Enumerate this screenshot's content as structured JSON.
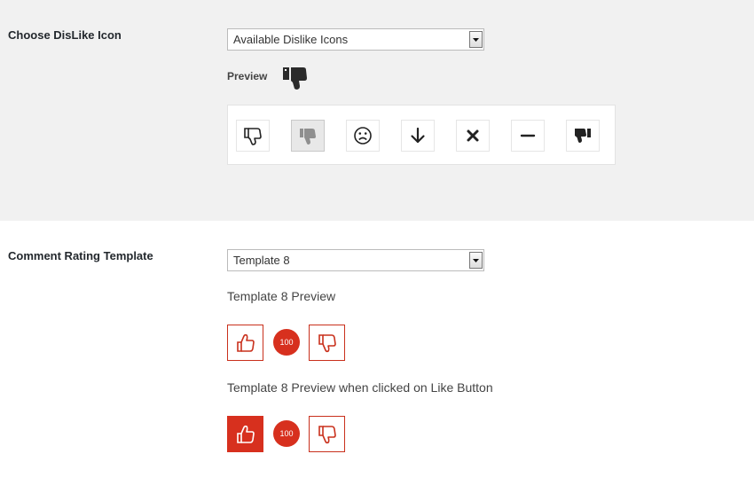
{
  "dislike_section": {
    "label": "Choose DisLike Icon",
    "select": {
      "value": "Available Dislike Icons"
    },
    "preview_label": "Preview",
    "preview_icon": "thumbs-down-solid-icon",
    "icons": [
      {
        "name": "thumbs-down-outline-icon"
      },
      {
        "name": "thumbs-down-filled-gray-icon",
        "selected": true
      },
      {
        "name": "frown-face-icon"
      },
      {
        "name": "arrow-down-icon"
      },
      {
        "name": "times-icon"
      },
      {
        "name": "minus-icon"
      },
      {
        "name": "thumbs-down-solid-icon"
      }
    ]
  },
  "template_section": {
    "label": "Comment Rating Template",
    "select": {
      "value": "Template 8"
    },
    "preview_caption": "Template 8 Preview",
    "clicked_caption": "Template 8 Preview when clicked on Like Button",
    "count": "100"
  },
  "colors": {
    "accent": "#d7301e",
    "panel_bg": "#f1f1f1"
  }
}
